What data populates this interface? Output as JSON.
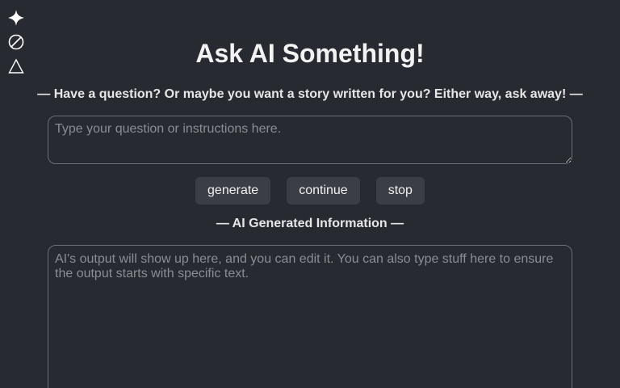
{
  "sidebar": {
    "icons": [
      "sparkle-icon",
      "no-entry-icon",
      "triangle-icon"
    ]
  },
  "header": {
    "title": "Ask AI Something!",
    "subtitle": "— Have a question? Or maybe you want a story written for you? Either way, ask away! —"
  },
  "prompt": {
    "value": "",
    "placeholder": "Type your question or instructions here."
  },
  "controls": {
    "generate_label": "generate",
    "continue_label": "continue",
    "stop_label": "stop"
  },
  "output": {
    "heading": "— AI Generated Information —",
    "value": "",
    "placeholder": "AI's output will show up here, and you can edit it. You can also type stuff here to ensure the output starts with specific text."
  },
  "colors": {
    "background": "#272a31",
    "button_bg": "#3b3e46",
    "border": "#6b6e75",
    "placeholder": "#8a8d93"
  }
}
